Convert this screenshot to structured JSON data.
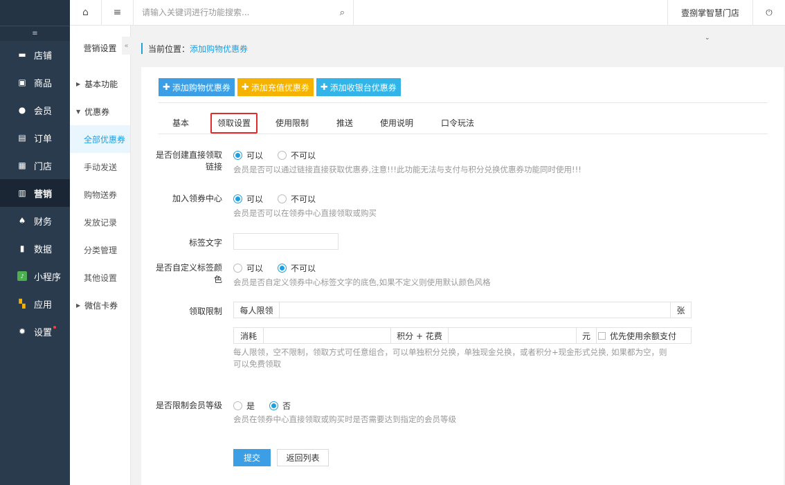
{
  "topbar": {
    "search_placeholder": "请输入关键词进行功能搜索...",
    "store_name": "壹捌掌智慧门店"
  },
  "sidebar": {
    "items": [
      {
        "label": "店铺",
        "icon": "store-icon"
      },
      {
        "label": "商品",
        "icon": "goods-icon"
      },
      {
        "label": "会员",
        "icon": "user-icon"
      },
      {
        "label": "订单",
        "icon": "order-icon"
      },
      {
        "label": "门店",
        "icon": "shop-icon"
      },
      {
        "label": "营销",
        "icon": "gift-icon"
      },
      {
        "label": "财务",
        "icon": "money-bag-icon"
      },
      {
        "label": "数据",
        "icon": "chart-icon"
      },
      {
        "label": "小程序",
        "icon": "miniprogram-icon"
      },
      {
        "label": "应用",
        "icon": "apps-icon"
      },
      {
        "label": "设置",
        "icon": "gear-icon"
      }
    ]
  },
  "subnav": {
    "title": "营销设置",
    "items": [
      "基本功能",
      "优惠券",
      "全部优惠券",
      "手动发送",
      "购物送券",
      "发放记录",
      "分类管理",
      "其他设置",
      "微信卡券"
    ]
  },
  "breadcrumb": {
    "prefix": "当前位置：",
    "current": "添加购物优惠券"
  },
  "actions": {
    "add_shopping": "添加购物优惠券",
    "add_recharge": "添加充值优惠券",
    "add_cashier": "添加收银台优惠券"
  },
  "tabs": [
    "基本",
    "领取设置",
    "使用限制",
    "推送",
    "使用说明",
    "口令玩法"
  ],
  "form": {
    "direct_link": {
      "label_line1": "是否创建直接领取",
      "label_line2": "链接",
      "opt_yes": "可以",
      "opt_no": "不可以",
      "help": "会员是否可以通过链接直接获取优惠券,注意!!!此功能无法与支付与积分兑换优惠券功能同时使用!!!"
    },
    "center": {
      "label": "加入领券中心",
      "opt_yes": "可以",
      "opt_no": "不可以",
      "help": "会员是否可以在领券中心直接领取或购买"
    },
    "tag_text": {
      "label": "标签文字",
      "value": ""
    },
    "tag_color": {
      "label_line1": "是否自定义标签颜",
      "label_line2": "色",
      "opt_yes": "可以",
      "opt_no": "不可以",
      "help": "会员是否自定义领券中心标签文字的底色,如果不定义则使用默认颜色风格"
    },
    "limit": {
      "label": "领取限制",
      "per_person": "每人限领",
      "unit": "张",
      "consume": "消耗",
      "points_plus_fee": "积分 + 花费",
      "yuan": "元",
      "balance_first": "优先使用余额支付",
      "help_line1": "每人限领，空不限制，领取方式可任意组合，可以单独积分兑换，单独现金兑换，或者积分+现金形式兑换, 如果都为空，则",
      "help_line2": "可以免费领取"
    },
    "level": {
      "label": "是否限制会员等级",
      "opt_yes": "是",
      "opt_no": "否",
      "help": "会员在领券中心直接领取或购买时是否需要达到指定的会员等级"
    }
  },
  "buttons": {
    "submit": "提交",
    "back": "返回列表"
  }
}
